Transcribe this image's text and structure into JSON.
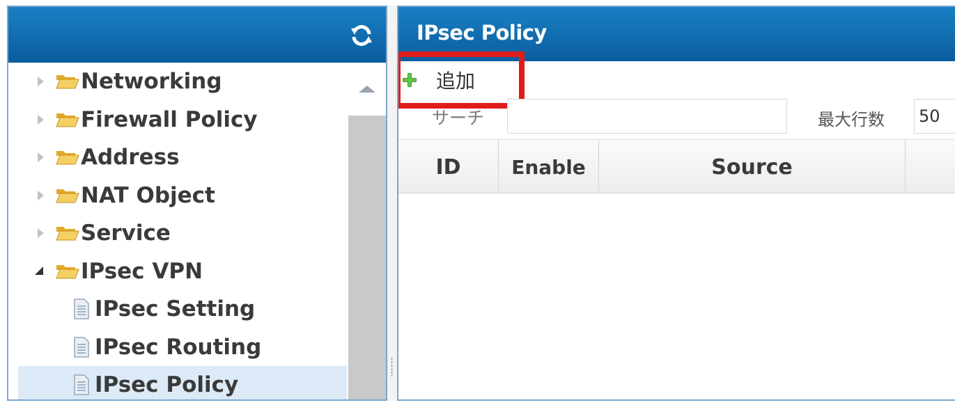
{
  "sidebar": {
    "refresh_icon": "refresh-icon",
    "items": [
      {
        "label": "Networking",
        "type": "folder",
        "state": "collapsed"
      },
      {
        "label": "Firewall Policy",
        "type": "folder",
        "state": "collapsed"
      },
      {
        "label": "Address",
        "type": "folder",
        "state": "collapsed"
      },
      {
        "label": "NAT Object",
        "type": "folder",
        "state": "collapsed"
      },
      {
        "label": "Service",
        "type": "folder",
        "state": "collapsed"
      },
      {
        "label": "IPsec VPN",
        "type": "folder",
        "state": "expanded"
      },
      {
        "label": "IPsec Setting",
        "type": "page",
        "level": 2
      },
      {
        "label": "IPsec Routing",
        "type": "page",
        "level": 2
      },
      {
        "label": "IPsec Policy",
        "type": "page",
        "level": 2,
        "selected": true
      }
    ]
  },
  "main": {
    "title": "IPsec Policy",
    "toolbar": {
      "add_label": "追加",
      "add_icon": "plus-icon",
      "highlighted": true
    },
    "search": {
      "label": "サーチ",
      "value": ""
    },
    "max_rows": {
      "label": "最大行数",
      "value": "50"
    },
    "table": {
      "columns": [
        "ID",
        "Enable",
        "Source",
        ""
      ],
      "rows": []
    }
  },
  "colors": {
    "header_blue": "#0a6db5",
    "selected_row": "#dbeaf6",
    "highlight_red": "#e01b1b",
    "plus_green": "#3aa02a"
  }
}
